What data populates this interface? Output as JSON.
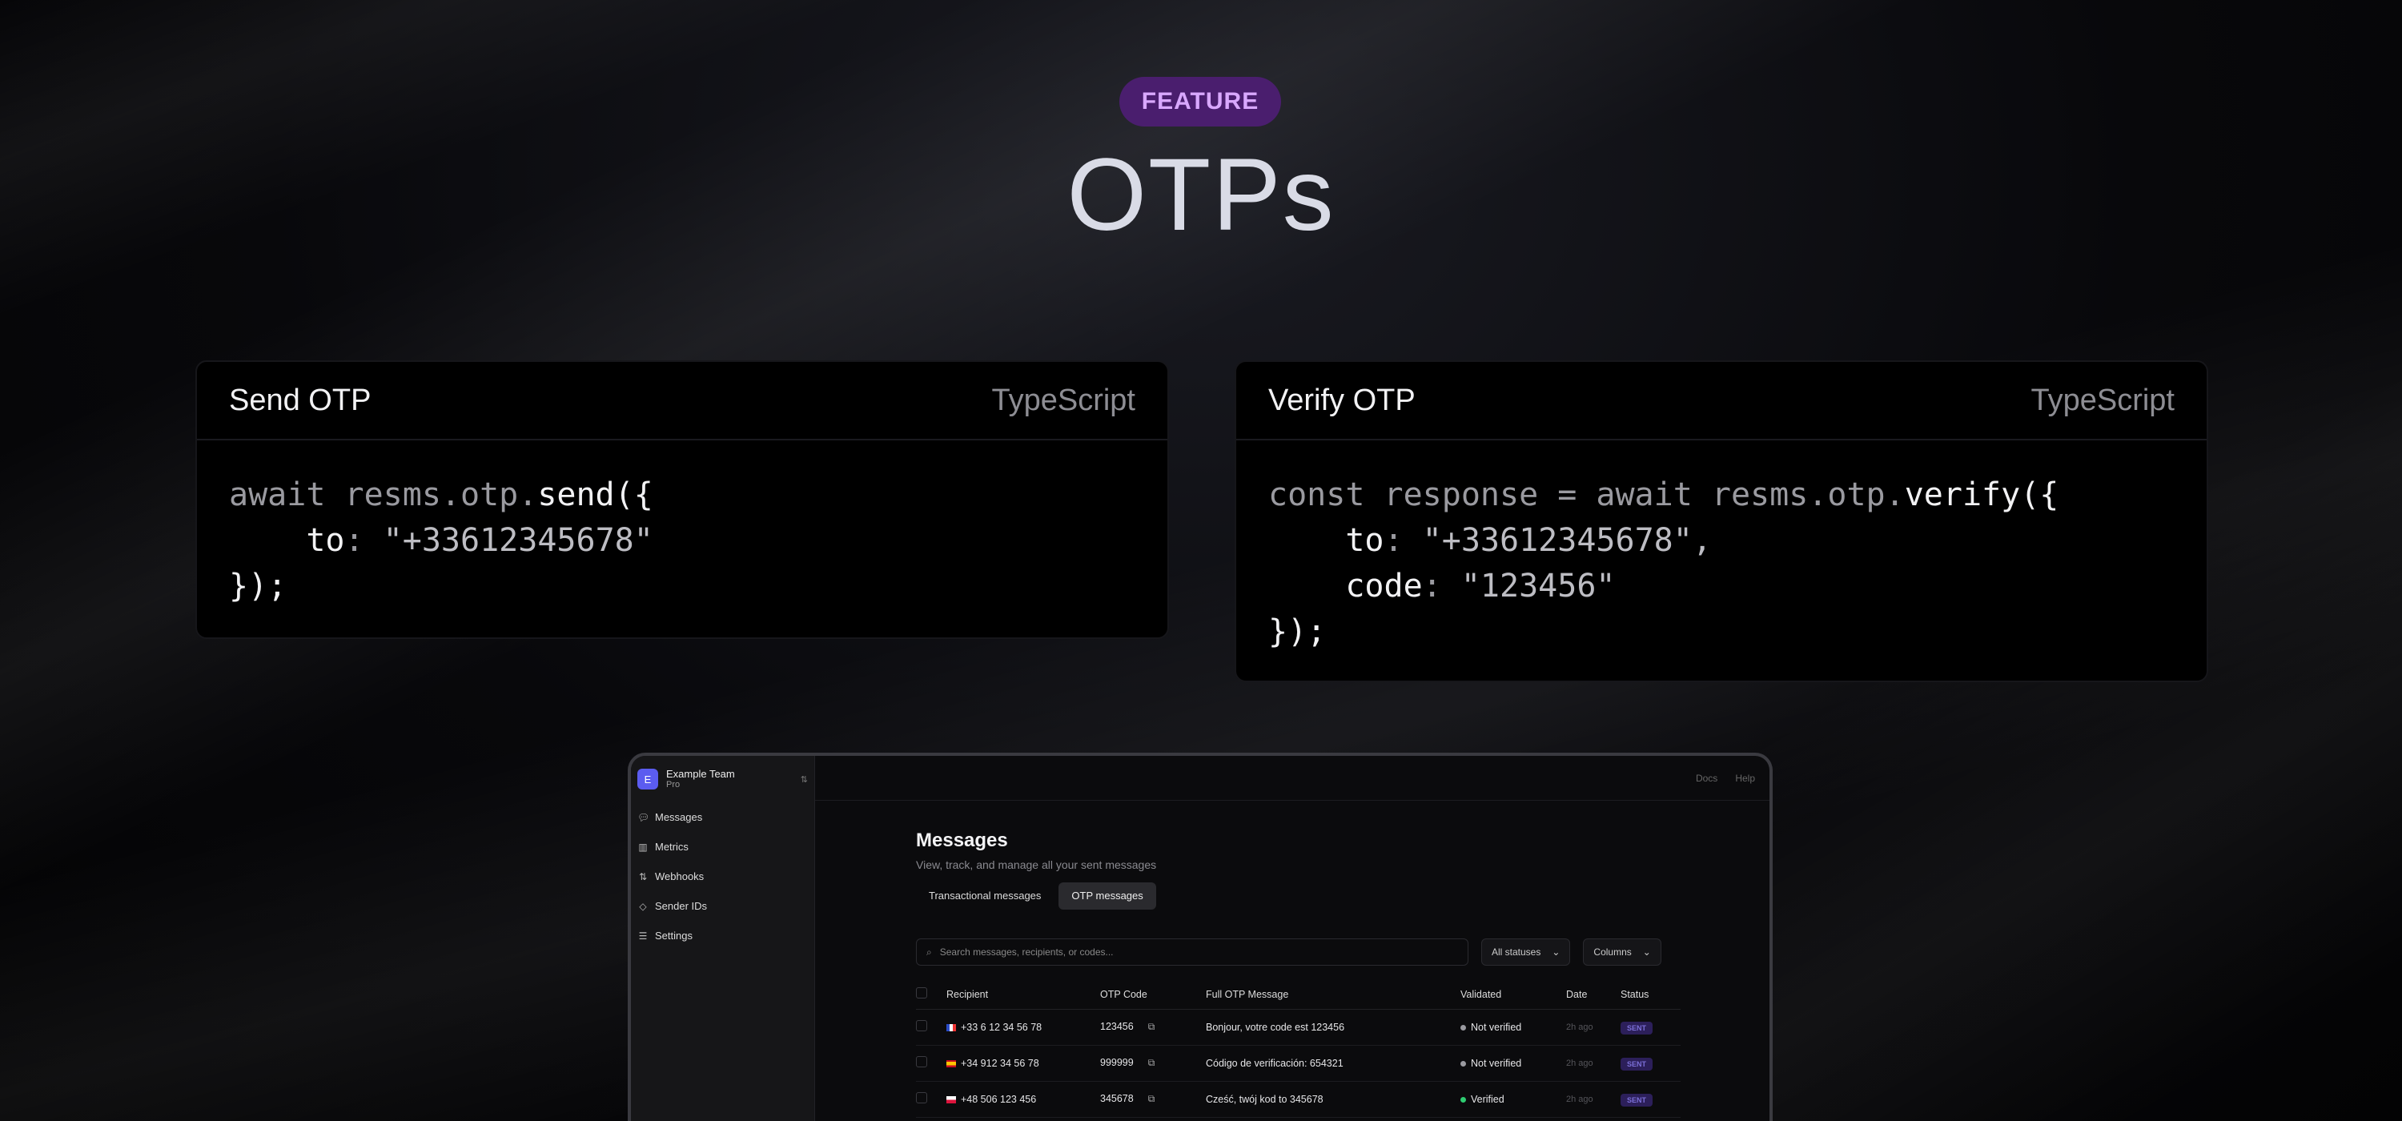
{
  "hero": {
    "badge": "FEATURE",
    "title": "OTPs"
  },
  "cards": [
    {
      "title": "Send OTP",
      "language": "TypeScript"
    },
    {
      "title": "Verify OTP",
      "language": "TypeScript"
    }
  ],
  "code": {
    "send": {
      "l1_a": "await resms.otp.",
      "l1_b": "send({",
      "l2_key": "to",
      "l2_sep": ": ",
      "l2_val": "\"+33612345678\"",
      "l3": "});"
    },
    "verify": {
      "l1_a": "const response = await resms.otp.",
      "l1_b": "verify({",
      "l2_key": "to",
      "l2_sep": ": ",
      "l2_val": "\"+33612345678\",",
      "l3_key": "code",
      "l3_sep": ": ",
      "l3_val": "\"123456\"",
      "l4": "});"
    }
  },
  "app": {
    "team": {
      "initial": "E",
      "name": "Example Team",
      "plan": "Pro"
    },
    "nav": [
      {
        "label": "Messages",
        "icon": "chat-icon"
      },
      {
        "label": "Metrics",
        "icon": "bar-chart-icon"
      },
      {
        "label": "Webhooks",
        "icon": "webhook-icon"
      },
      {
        "label": "Sender IDs",
        "icon": "tag-icon"
      },
      {
        "label": "Settings",
        "icon": "sliders-icon"
      }
    ],
    "topbar": {
      "docs": "Docs",
      "help": "Help"
    },
    "page": {
      "title": "Messages",
      "subtitle": "View, track, and manage all your sent messages",
      "tabs": [
        "Transactional messages",
        "OTP messages"
      ],
      "search_placeholder": "Search messages, recipients, or codes...",
      "status_filter": "All statuses",
      "columns_button": "Columns"
    },
    "table": {
      "headers": [
        "Recipient",
        "OTP Code",
        "Full OTP Message",
        "Validated",
        "Date",
        "Status"
      ],
      "rows": [
        {
          "recipient": "+33 6 12 34 56 78",
          "code": "123456",
          "message": "Bonjour, votre code est 123456",
          "validated": "Not verified",
          "date": "2h ago",
          "status": "SENT"
        },
        {
          "recipient": "+34 912 34 56 78",
          "code": "999999",
          "message": "Código de verificación: 654321",
          "validated": "Not verified",
          "date": "2h ago",
          "status": "SENT"
        },
        {
          "recipient": "+48 506 123 456",
          "code": "345678",
          "message": "Cześć, twój kod to 345678",
          "validated": "Verified",
          "date": "2h ago",
          "status": "SENT"
        }
      ]
    }
  },
  "colors": {
    "badge_bg": "#4a1e6e",
    "badge_text": "#d9a8ff",
    "verified": "#2ecc71",
    "not_verified": "#9a9aa0",
    "sent_badge": "#2c1f5a"
  }
}
